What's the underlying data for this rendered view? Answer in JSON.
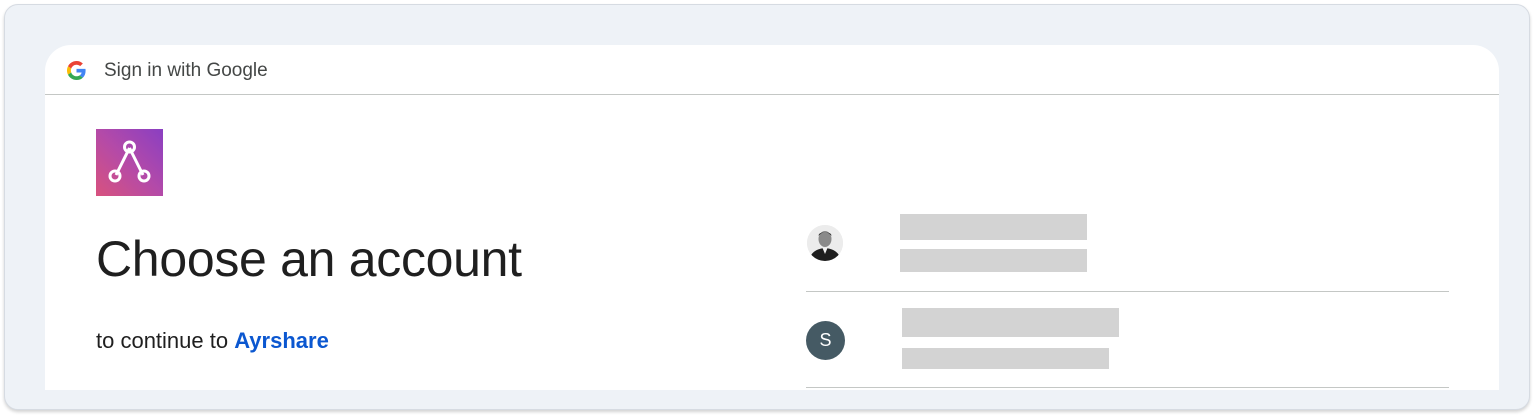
{
  "header": {
    "title": "Sign in with Google",
    "icon": "google-g-icon"
  },
  "app": {
    "logo_icon": "ayrshare-logo-icon",
    "brand_gradient": [
      "#8a3fc2",
      "#d8527e"
    ]
  },
  "main": {
    "title": "Choose an account",
    "subtitle_prefix": "to continue to",
    "app_name": "Ayrshare"
  },
  "accounts": [
    {
      "avatar": "profile-photo",
      "name": "",
      "email": ""
    },
    {
      "avatar_letter": "S",
      "avatar_color": "#455a64",
      "name": "",
      "email": ""
    }
  ],
  "colors": {
    "link": "#0b57d0",
    "text": "#1f1f1f",
    "divider": "#c4c7c5",
    "frame_bg": "#eef2f7"
  }
}
